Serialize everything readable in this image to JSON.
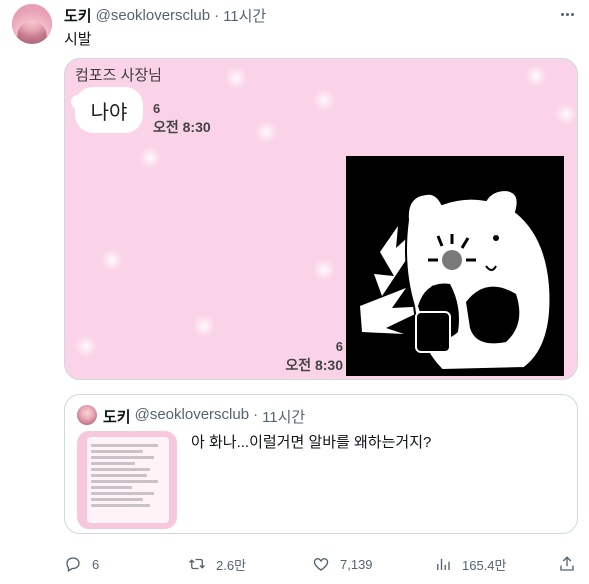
{
  "author": {
    "name": "도키",
    "handle": "@seokloversclub",
    "time": "11시간"
  },
  "tweet": {
    "text": "시발"
  },
  "media": {
    "chat_name": "컴포즈 사장님",
    "bubble_text": "나야",
    "read_count_1": "6",
    "time_1": "오전 8:30",
    "read_count_2": "6",
    "time_2": "오전 8:30"
  },
  "quote": {
    "name": "도키",
    "handle": "@seokloversclub",
    "time": "11시간",
    "text": "아 화나...이럴거면 알바를 왜하는거지?"
  },
  "actions": {
    "replies": "6",
    "retweets": "2.6만",
    "likes": "7,139",
    "views": "165.4만"
  },
  "icons": {
    "more": "more-icon",
    "reply": "reply-icon",
    "retweet": "retweet-icon",
    "like": "heart-icon",
    "views": "views-icon",
    "share": "share-icon"
  },
  "colors": {
    "text": "#0f1419",
    "secondary": "#536471",
    "media_bg": "#fbd3e8",
    "border": "#cfd9de"
  }
}
